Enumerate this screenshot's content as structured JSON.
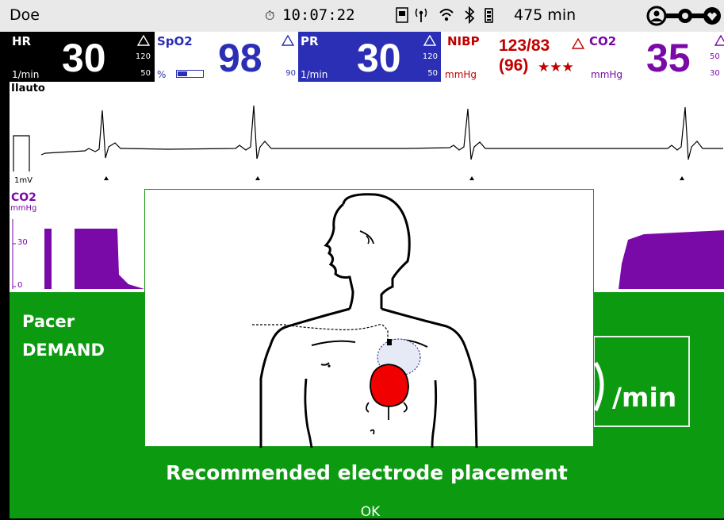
{
  "status": {
    "patient_name": "Doe",
    "time": "10:07:22",
    "battery_time": "475 min"
  },
  "tiles": {
    "hr": {
      "label": "HR",
      "value": "30",
      "unit": "1/min",
      "limit_high": "120",
      "limit_low": "50"
    },
    "spo2": {
      "label": "SpO2",
      "value": "98",
      "unit": "%",
      "limit_low": "90"
    },
    "pr": {
      "label": "PR",
      "value": "30",
      "unit": "1/min",
      "limit_high": "120",
      "limit_low": "50"
    },
    "nibp": {
      "label": "NIBP",
      "value": "123/83",
      "mean": "(96)",
      "quality": "★★★",
      "unit": "mmHg"
    },
    "co2": {
      "label": "CO2",
      "value": "35",
      "unit": "mmHg",
      "limit_high": "50",
      "limit_low": "30"
    }
  },
  "ecg": {
    "lead": "IIauto",
    "scale": "1mV"
  },
  "co2_wave": {
    "label": "CO2",
    "unit": "mmHg",
    "tick_30": "30",
    "tick_0": "0"
  },
  "pacer": {
    "mode_line1": "Pacer",
    "mode_line2": "DEMAND",
    "rate_unit": "/min"
  },
  "dialog": {
    "message": "Recommended electrode placement",
    "ok_label": "OK"
  },
  "colors": {
    "hr_bg": "#000000",
    "spo2": "#2b2fb5",
    "pr_bg": "#2b2fb5",
    "nibp": "#c00000",
    "co2": "#7a0aa8",
    "pacer_green": "#0c9a10"
  }
}
